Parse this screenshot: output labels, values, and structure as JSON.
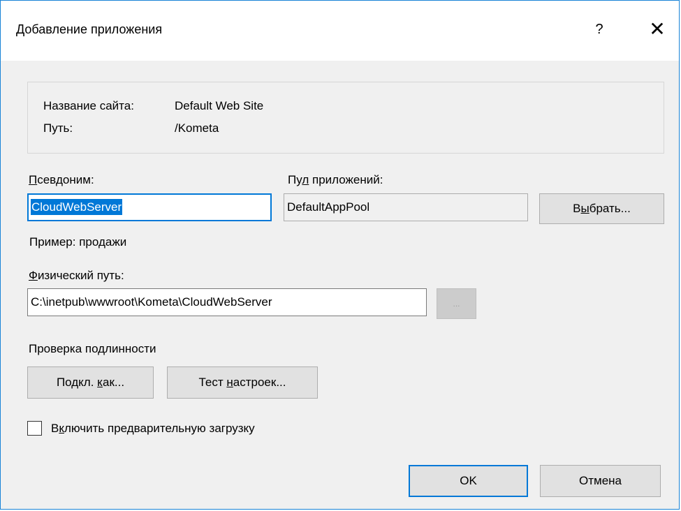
{
  "window": {
    "title": "Добавление приложения",
    "help_glyph": "?",
    "close_glyph": "✕"
  },
  "site_info": {
    "site_name_label": "Название сайта:",
    "site_name_value": "Default Web Site",
    "path_label": "Путь:",
    "path_value": "/Kometa"
  },
  "alias": {
    "label_access": "П",
    "label_rest": "севдоним:",
    "value": "CloudWebServer",
    "example": "Пример: продажи"
  },
  "app_pool": {
    "label_pre": "Пу",
    "label_access": "л",
    "label_rest": " приложений:",
    "value": "DefaultAppPool",
    "select_pre": "В",
    "select_access": "ы",
    "select_rest": "брать..."
  },
  "physical_path": {
    "label_access": "Ф",
    "label_rest": "изический путь:",
    "value": "C:\\inetpub\\wwwroot\\Kometa\\CloudWebServer",
    "browse_label": "..."
  },
  "auth": {
    "heading": "Проверка подлинности",
    "connect_pre": "Подкл. ",
    "connect_access": "к",
    "connect_rest": "ак...",
    "test_pre": "Тест ",
    "test_access": "н",
    "test_rest": "астроек..."
  },
  "preload": {
    "checked": false,
    "label_pre": "В",
    "label_access": "к",
    "label_rest": "лючить предварительную загрузку"
  },
  "footer": {
    "ok_label": "OK",
    "cancel_label": "Отмена"
  },
  "colors": {
    "accent": "#0078d7",
    "dialog_bg": "#f0f0f0",
    "button_bg": "#e1e1e1"
  }
}
